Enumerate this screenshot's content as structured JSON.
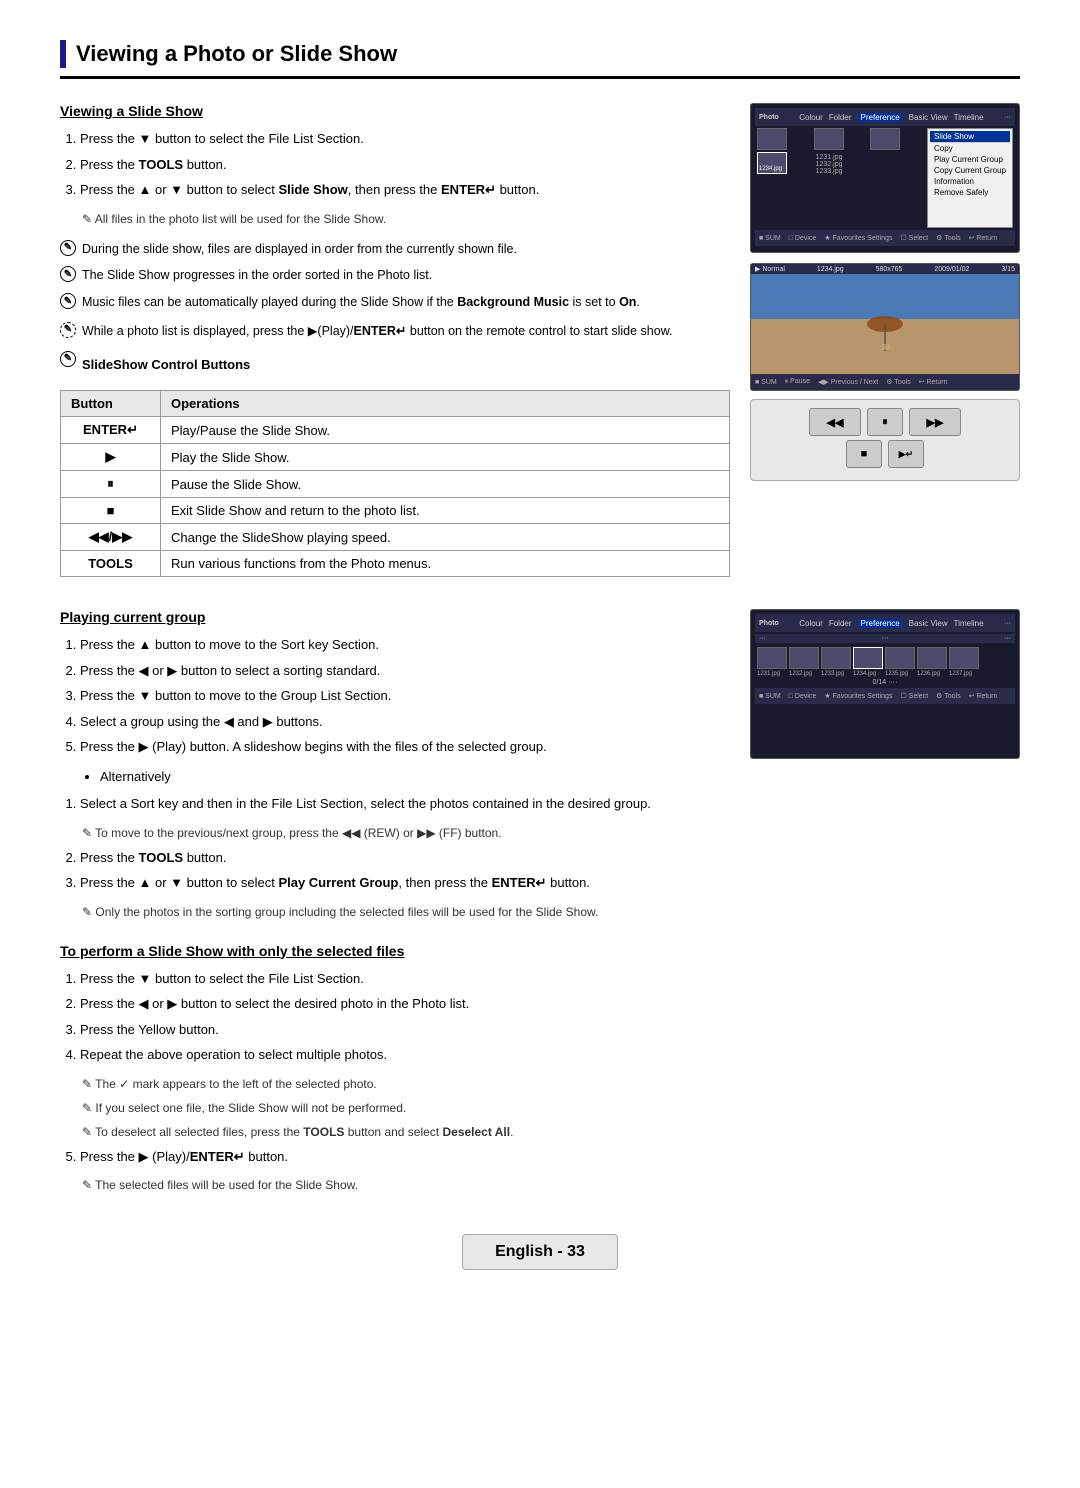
{
  "page": {
    "title": "Viewing a Photo or Slide Show",
    "footer": "English - 33"
  },
  "sections": {
    "viewing_slide_show": {
      "title": "Viewing a Slide Show",
      "steps": [
        "Press the ▼ button to select the File List Section.",
        "Press the TOOLS button.",
        "Press the ▲ or ▼ button to select Slide Show, then press the ENTER↵ button."
      ],
      "step3_note": "All files in the photo list will be used for the Slide Show.",
      "notes": [
        "During the slide show, files are displayed in order from the currently shown file.",
        "The Slide Show progresses in the order sorted in the Photo list.",
        "Music files can be automatically played during the Slide Show if the Background Music is set to On."
      ],
      "note4": "While a photo list is displayed, press the ▶(Play)/ENTER↵ button on the remote control to start slide show.",
      "slideshow_control_title": "SlideShow Control Buttons",
      "table": {
        "headers": [
          "Button",
          "Operations"
        ],
        "rows": [
          [
            "ENTER↵",
            "Play/Pause the Slide Show."
          ],
          [
            "▶",
            "Play the Slide Show."
          ],
          [
            "⏸",
            "Pause the Slide Show."
          ],
          [
            "■",
            "Exit Slide Show and return to the photo list."
          ],
          [
            "◀◀/▶▶",
            "Change the SlideShow playing speed."
          ],
          [
            "TOOLS",
            "Run various functions from the Photo menus."
          ]
        ]
      }
    },
    "playing_current_group": {
      "title": "Playing current group",
      "steps": [
        "Press the ▲ button to move to the Sort key Section.",
        "Press the ◀ or ▶ button to select a sorting standard.",
        "Press the ▼ button to move to the Group List Section.",
        "Select a group using the ◀ and ▶ buttons.",
        "Press the ▶ (Play) button. A slideshow begins with the files of the selected group."
      ],
      "alternatively": "Alternatively",
      "alt_steps": [
        "Select a Sort key and then in the File List Section, select the photos contained in the desired group.",
        "To move to the previous/next group, press the ◀◀ (REW) or ▶▶ (FF) button.",
        "Press the TOOLS button.",
        "Press the ▲ or ▼ button to select Play Current Group, then press the ENTER↵ button."
      ],
      "alt_note": "Only the photos in the sorting group including the selected files will be used for the Slide Show."
    },
    "selected_files": {
      "title": "To perform a Slide Show with only the selected files",
      "steps": [
        "Press the ▼ button to select the File List Section.",
        "Press the ◀ or ▶ button to select the desired photo in the Photo list.",
        "Press the Yellow button.",
        "Repeat the above operation to select multiple photos."
      ],
      "step4_notes": [
        "The ✓ mark appears to the left of the selected photo.",
        "If you select one file, the Slide Show will not be performed.",
        "To deselect all selected files, press the TOOLS button and select Deselect All."
      ],
      "step5": "Press the ▶ (Play)/ENTER↵ button.",
      "step5_note": "The selected files will be used for the Slide Show."
    }
  },
  "screen1": {
    "tabs": [
      "Colour",
      "Folder",
      "Preference",
      "Basic View",
      "Timeline"
    ],
    "active_tab": "Preference",
    "context_menu": {
      "title": "Slide Show",
      "items": [
        "Copy",
        "Play Current Group",
        "Copy Current Group",
        "Information",
        "Remove Safely"
      ]
    },
    "active_item": "Slide Show",
    "bottombar": [
      "SUM",
      "Device",
      "Favourites Settings",
      "Select",
      "Tools",
      "Return"
    ]
  },
  "screen2": {
    "mode": "Normal",
    "filename": "1234.jpg",
    "resolution": "580x765",
    "date": "2009/01/02",
    "page": "3/15",
    "bottombar": [
      "SUM",
      "Pause",
      "Previous / Next",
      "Tools",
      "Return"
    ]
  },
  "remote_buttons": {
    "row1": [
      "◀◀",
      "⏸",
      "▶▶"
    ],
    "row2": [
      "■",
      "▶⁻",
      ""
    ]
  },
  "screen3": {
    "tabs": [
      "Colour",
      "Folder",
      "Preference",
      "Basic View",
      "Timeline"
    ],
    "active_tab": "Preference",
    "bottombar": [
      "SUM",
      "Device",
      "Favourites Settings",
      "Select",
      "Tools",
      "Return"
    ]
  }
}
